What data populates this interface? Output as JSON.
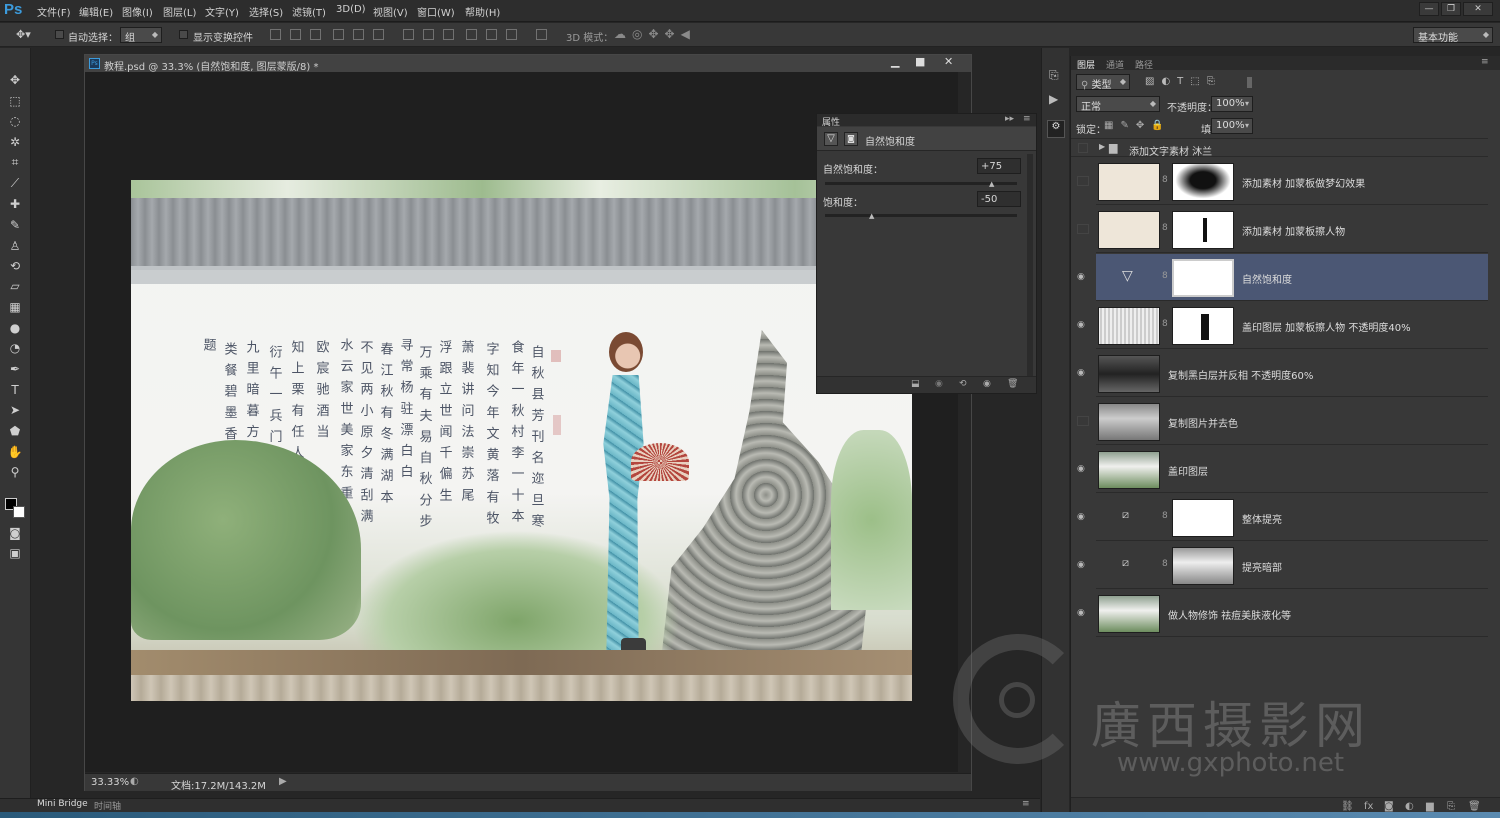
{
  "app": {
    "logo": "Ps"
  },
  "menu": [
    "文件(F)",
    "编辑(E)",
    "图像(I)",
    "图层(L)",
    "文字(Y)",
    "选择(S)",
    "滤镜(T)",
    "3D(D)",
    "视图(V)",
    "窗口(W)",
    "帮助(H)"
  ],
  "options": {
    "auto_select_label": "自动选择：",
    "auto_select_value": "组",
    "show_transform_label": "显示变换控件",
    "mode_3d_label": "3D 模式：",
    "workspace": "基本功能"
  },
  "document": {
    "title": "教程.psd @ 33.3% (自然饱和度, 图层蒙版/8) *",
    "zoom": "33.33%",
    "doc_size": "文档:17.2M/143.2M"
  },
  "calligraphy": [
    "自 秋 县 芳 刊 名 迩 旦 寒",
    "食 年 一 秋 村 李 一 十 本",
    "字 知 今 年 文 黄 落 有 牧",
    "萧 裴 讲 问 法 崇 苏 尾",
    "浮 跟 立 世 闻 千 偏 生",
    "万 乘 有 夫 易 自 秋 分 步",
    "寻 常 杨 驻 漂 白 白",
    "春 江 秋 有 冬 满 湖 本",
    "不 见 两 小 原 夕 清 刮 满",
    "水 云 家 世 美 家 东 重",
    "欧 宸 驰 酒 当 ",
    "知 上 栗 有 任 人 月",
    "衍 午 一 兵 门",
    "九 里 暗 暮 方 有 云",
    "类 餐 碧 墨 香 洲",
    "题 "
  ],
  "properties": {
    "tab": "属性",
    "header": "自然饱和度",
    "vibrance_label": "自然饱和度：",
    "vibrance_value": "+75",
    "vibrance_fraction": 0.875,
    "saturation_label": "饱和度：",
    "saturation_value": "-50",
    "saturation_fraction": 0.25
  },
  "layers_panel": {
    "tabs": [
      "图层",
      "通道",
      "路径"
    ],
    "kind_filter": "类型",
    "blend_mode": "正常",
    "opacity_label": "不透明度：",
    "opacity_value": "100%",
    "lock_label": "锁定：",
    "fill_label": "填充：",
    "fill_value": "100%",
    "group_name": "添加文字素材  沐兰",
    "layers": [
      {
        "name": "添加素材  加蒙板做梦幻效果",
        "visible": false
      },
      {
        "name": "添加素材  加蒙板擦人物",
        "visible": false
      },
      {
        "name": "自然饱和度",
        "visible": true
      },
      {
        "name": "盖印图层  加蒙板擦人物    不透明度40%",
        "visible": true
      },
      {
        "name": "复制黑白层并反相    不透明度60%",
        "visible": true
      },
      {
        "name": "复制图片并去色",
        "visible": false
      },
      {
        "name": "盖印图层",
        "visible": true
      },
      {
        "name": "整体提亮",
        "visible": true
      },
      {
        "name": "提亮暗部",
        "visible": true
      },
      {
        "name": "做人物修饰  祛痘美肤液化等",
        "visible": true
      }
    ]
  },
  "watermark": {
    "cn": "廣西摄影网",
    "url": "www.gxphoto.net"
  },
  "bottom_tabs": [
    "Mini Bridge",
    "时间轴"
  ],
  "colors": {
    "accent": "#3c9bdc",
    "selected_layer": "#4b5774",
    "panel": "#383838"
  }
}
